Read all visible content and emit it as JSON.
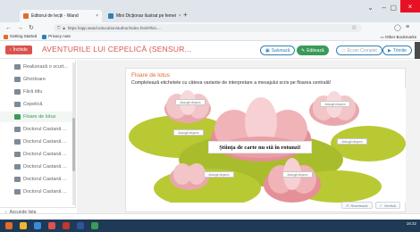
{
  "browser": {
    "tabs": [
      {
        "label": "Editorul de lecții - Wand",
        "color": "#e36b2b"
      },
      {
        "label": "Mini Dicționar ilustrat pe femei",
        "color": "#2f7fb3"
      }
    ],
    "new_tab": "+",
    "url": "https://app.wand.education/author/index.html#/lid=...",
    "bookmarks": [
      {
        "label": "Getting Started",
        "color": "#e36b2b"
      },
      {
        "label": "Privacy note",
        "color": "#2f7fb3"
      }
    ],
    "other_bookmarks": "Other Bookmarks"
  },
  "header": {
    "back_label": "Închide",
    "title": "AVENTURILE LUI CEPELICĂ (SENSUR...",
    "buttons": {
      "save": "Salvează",
      "edit": "Editează",
      "preview": "Ecran Complet",
      "next": "Trimite"
    }
  },
  "sidebar": {
    "items": [
      {
        "label": "Realizează o scurt...",
        "active": false
      },
      {
        "label": "Ghicitoare",
        "active": false
      },
      {
        "label": "Fără titlu",
        "active": false
      },
      {
        "label": "Cepelică",
        "active": false
      },
      {
        "label": "Floare de lotus",
        "active": true
      },
      {
        "label": "Doctorul Castană ...",
        "active": false
      },
      {
        "label": "Doctorul Castană ...",
        "active": false
      },
      {
        "label": "Doctorul Castană ...",
        "active": false
      },
      {
        "label": "Doctorul Castană ...",
        "active": false
      },
      {
        "label": "Doctorul Castană ...",
        "active": false
      },
      {
        "label": "Doctorul Castană ...",
        "active": false
      }
    ],
    "footer": "Ascunde lista"
  },
  "content": {
    "title": "Floare de lotus",
    "instruction": "Completează etichetele cu câteva variante de interpretare a mesajului scris pe floarea centrală!",
    "center_label": "Știința de carte nu stă în rotunzi!",
    "placeholder": "Adaugă răspuns",
    "footer_buttons": {
      "reset": "Resetează",
      "check": "Verifică"
    }
  },
  "taskbar": {
    "time": "16:32",
    "date": ""
  },
  "colors": {
    "accent_red": "#d9534f",
    "accent_green": "#3a9a58",
    "accent_blue": "#2f7fb3",
    "title_orange": "#e36b2b"
  }
}
